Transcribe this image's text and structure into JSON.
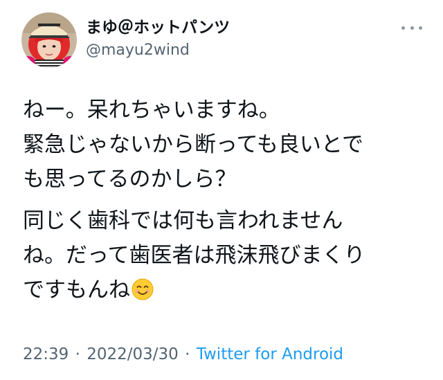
{
  "tweet": {
    "author": {
      "display_name": "まゆ＠ホットパンツ",
      "handle": "@mayu2wind"
    },
    "more_icon": "ellipsis-icon",
    "body": {
      "paragraphs": [
        [
          "ねー。呆れちゃいますね。",
          "緊急じゃないから断っても良いとで",
          "も思ってるのかしら？"
        ],
        [
          "同じく歯科では何も言われません",
          "ね。だって歯医者は飛沫飛びまくり",
          "ですもんね"
        ]
      ],
      "emoji": "smiling-face-icon"
    },
    "meta": {
      "time": "22:39",
      "separator": "·",
      "date": "2022/03/30",
      "client": "Twitter for Android"
    },
    "colors": {
      "text": "#0f1419",
      "secondary": "#536471",
      "link": "#1d9bf0"
    }
  }
}
